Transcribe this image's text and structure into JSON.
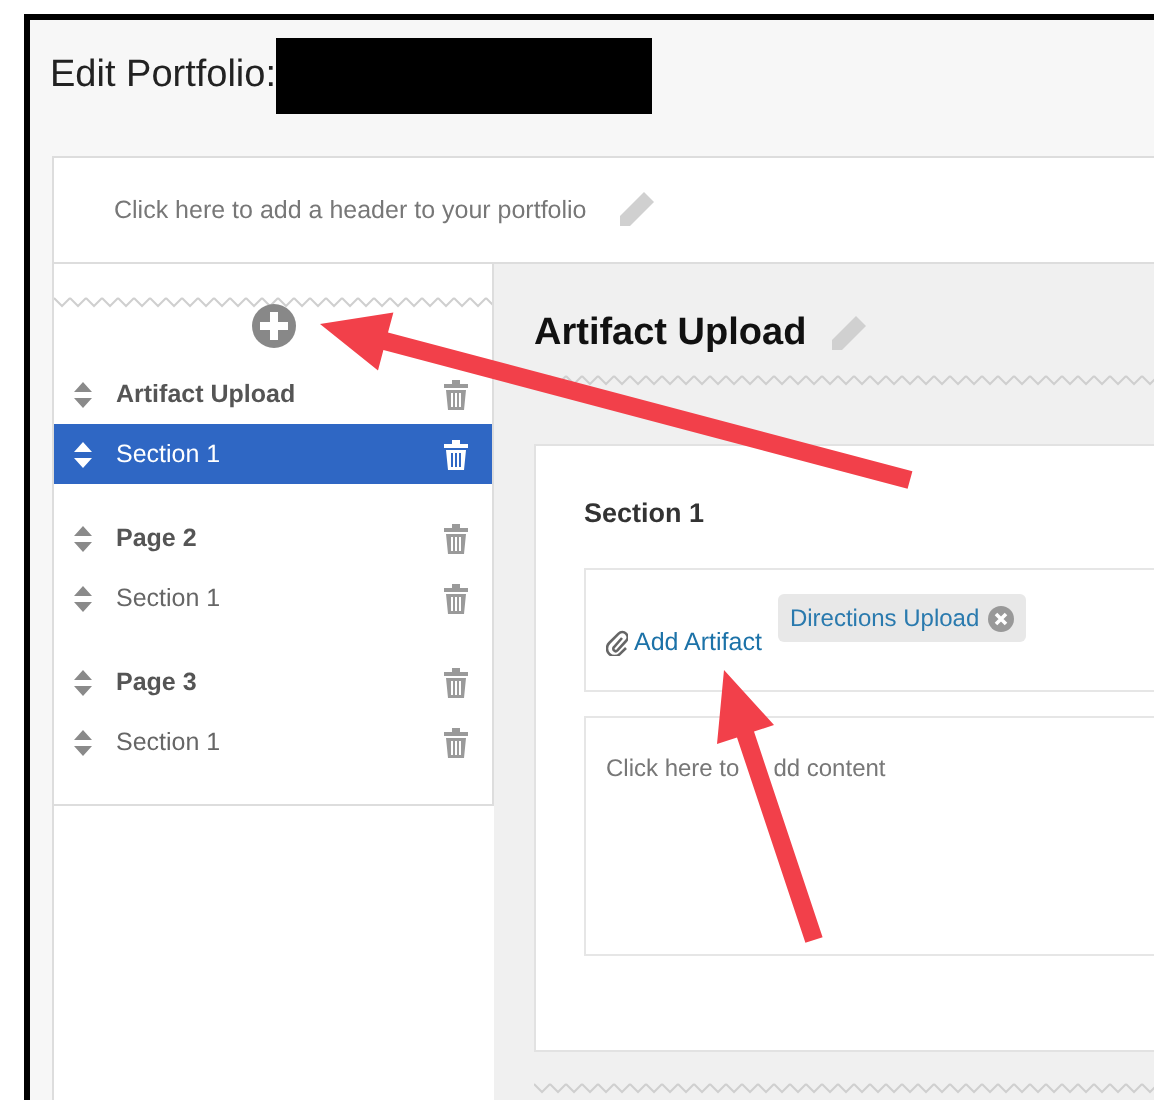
{
  "window": {
    "title": "Edit Portfolio:"
  },
  "header_prompt": "Click here to add a header to your portfolio",
  "sidebar": {
    "pages": [
      {
        "label": "Artifact Upload",
        "selected": false,
        "children": [
          {
            "label": "Section 1",
            "selected": true
          }
        ]
      },
      {
        "label": "Page 2",
        "selected": false,
        "children": [
          {
            "label": "Section 1",
            "selected": false
          }
        ]
      },
      {
        "label": "Page 3",
        "selected": false,
        "children": [
          {
            "label": "Section 1",
            "selected": false
          }
        ]
      }
    ]
  },
  "page_title": "Artifact Upload",
  "section": {
    "title": "Section 1",
    "add_artifact": "Add Artifact",
    "artifacts": [
      "Directions Upload"
    ],
    "content_prompt": [
      "Click here to",
      "dd content"
    ]
  }
}
